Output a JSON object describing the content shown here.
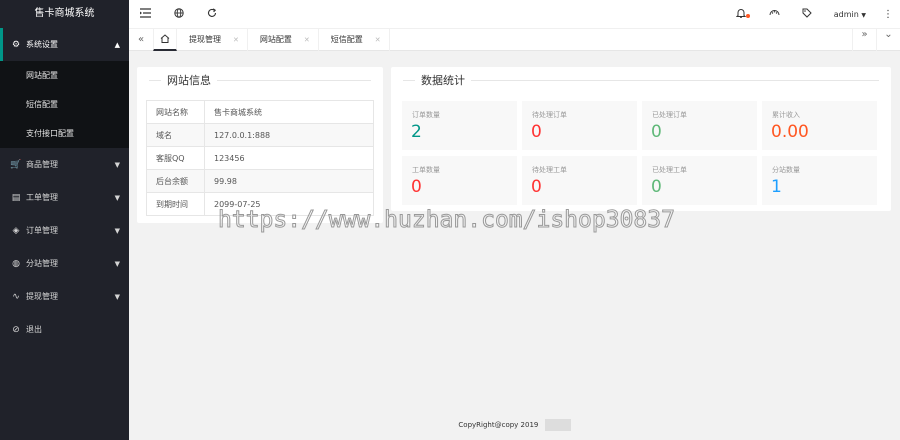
{
  "sidebar": {
    "logo": "售卡商城系统",
    "menus": [
      {
        "label": "系统设置",
        "icon": "gear-icon",
        "glyph": "⚙",
        "arrow": "▲"
      },
      {
        "label": "商品管理",
        "icon": "cart-icon",
        "glyph": "🛒",
        "arrow": "▼"
      },
      {
        "label": "工单管理",
        "icon": "ticket-icon",
        "glyph": "▤",
        "arrow": "▼"
      },
      {
        "label": "订单管理",
        "icon": "layers-icon",
        "glyph": "◈",
        "arrow": "▼"
      },
      {
        "label": "分站管理",
        "icon": "globe-icon",
        "glyph": "◍",
        "arrow": "▼"
      },
      {
        "label": "提现管理",
        "icon": "pulse-icon",
        "glyph": "∿",
        "arrow": "▼"
      },
      {
        "label": "退出",
        "icon": "shield-icon",
        "glyph": "⊘"
      }
    ],
    "submenu": [
      "网站配置",
      "短信配置",
      "支付接口配置"
    ]
  },
  "topbar": {
    "user": "admin",
    "user_arrow": "▼"
  },
  "tabs": [
    {
      "label": "提现管理"
    },
    {
      "label": "网站配置"
    },
    {
      "label": "短信配置"
    }
  ],
  "site_info": {
    "title": "网站信息",
    "rows": [
      {
        "key": "网站名称",
        "value": "售卡商城系统"
      },
      {
        "key": "域名",
        "value": "127.0.0.1:888"
      },
      {
        "key": "客服QQ",
        "value": "123456"
      },
      {
        "key": "后台余额",
        "value": "99.98"
      },
      {
        "key": "到期时间",
        "value": "2099-07-25"
      }
    ]
  },
  "stats": {
    "title": "数据统计",
    "items": [
      {
        "label": "订单数量",
        "value": "2",
        "color": "#009688"
      },
      {
        "label": "待处理订单",
        "value": "0",
        "color": "#ff3333"
      },
      {
        "label": "已处理订单",
        "value": "0",
        "color": "#5fb878"
      },
      {
        "label": "累计收入",
        "value": "0.00",
        "color": "#ff5722"
      },
      {
        "label": "工单数量",
        "value": "0",
        "color": "#ff3333"
      },
      {
        "label": "待处理工单",
        "value": "0",
        "color": "#ff3333"
      },
      {
        "label": "已处理工单",
        "value": "0",
        "color": "#5fb878"
      },
      {
        "label": "分站数量",
        "value": "1",
        "color": "#1e9fff"
      }
    ]
  },
  "footer": {
    "text": "CopyRight@copy 2019"
  },
  "watermark": "https://www.huzhan.com/ishop30837",
  "colors": {
    "sidebar_bg": "#20222a",
    "submenu_bg": "#101215",
    "accent": "#009688"
  }
}
